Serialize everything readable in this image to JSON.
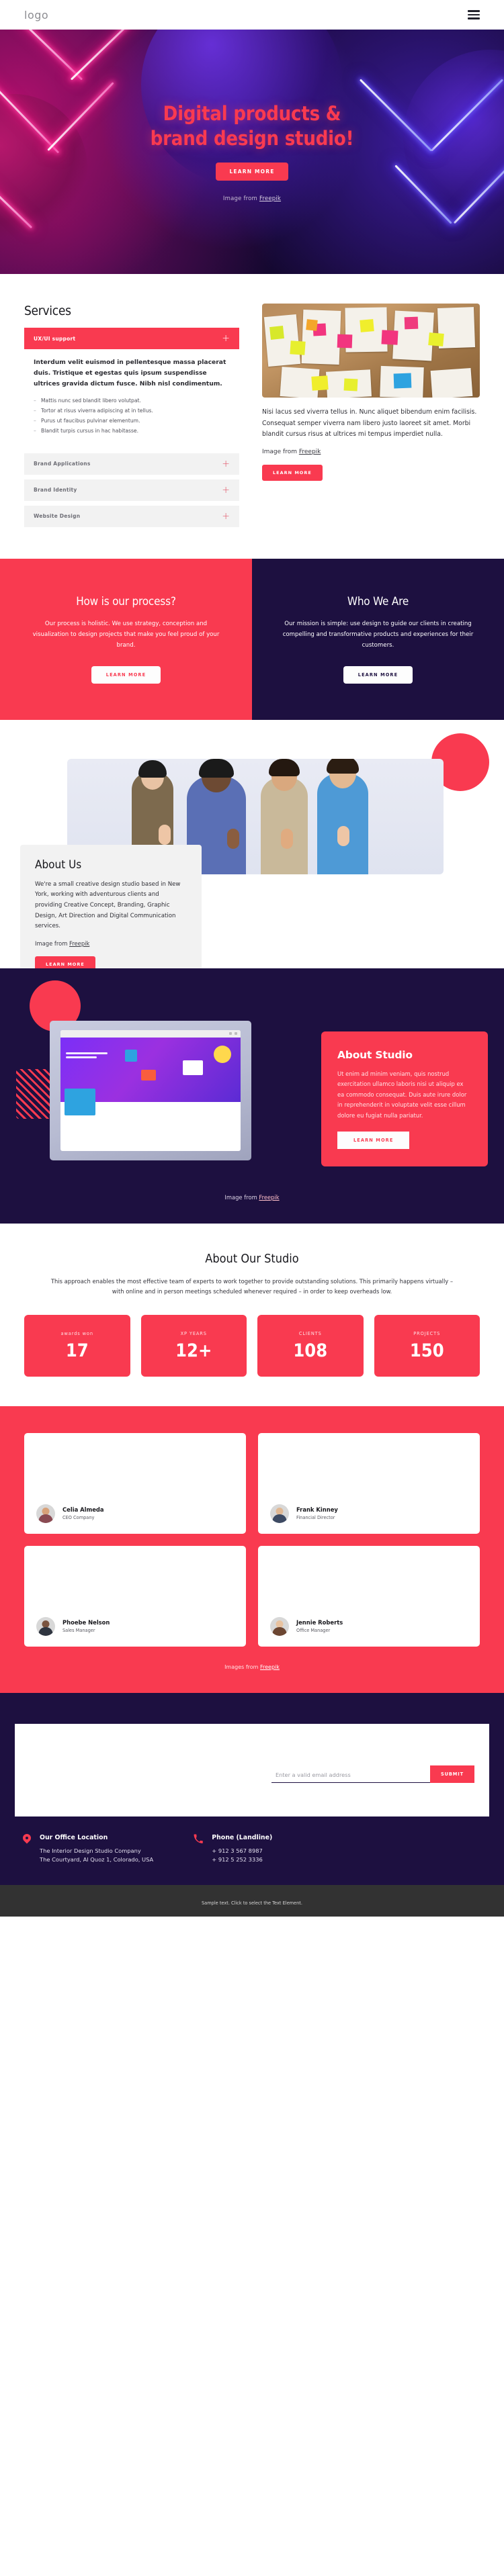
{
  "header": {
    "logo": "logo",
    "menu_icon": "hamburger-menu-icon"
  },
  "hero": {
    "title_line1": "Digital products &",
    "title_line2": "brand design studio!",
    "cta": "LEARN MORE",
    "credit_prefix": "Image from ",
    "credit_link": "Freepik"
  },
  "services": {
    "heading": "Services",
    "accordion": [
      {
        "label": "UX/UI support",
        "open": true,
        "body": "Interdum velit euismod in pellentesque massa placerat duis. Tristique et egestas quis ipsum suspendisse ultrices gravida dictum fusce. Nibh nisl condimentum.",
        "bullets": [
          "Mattis nunc sed blandit libero volutpat.",
          "Tortor at risus viverra adipiscing at in tellus.",
          "Purus ut faucibus pulvinar elementum.",
          "Blandit turpis cursus in hac habitasse."
        ]
      },
      {
        "label": "Brand Applications",
        "open": false
      },
      {
        "label": "Brand Identity",
        "open": false
      },
      {
        "label": "Website Design",
        "open": false
      }
    ],
    "paragraph": "Nisi lacus sed viverra tellus in. Nunc aliquet bibendum enim facilisis. Consequat semper viverra nam libero justo laoreet sit amet. Morbi blandit cursus risus at ultrices mi tempus imperdiet nulla.",
    "credit_prefix": "Image from ",
    "credit_link": "Freepik",
    "cta": "LEARN MORE"
  },
  "split": {
    "left": {
      "heading": "How is our process?",
      "text": "Our process is holistic. We use strategy, conception and visualization to design projects that make you feel proud of your brand.",
      "cta": "LEARN MORE"
    },
    "right": {
      "heading": "Who We Are",
      "text": "Our mission is simple: use design to guide our clients in creating compelling and transformative products and experiences for their customers.",
      "cta": "LEARN MORE"
    }
  },
  "about": {
    "heading": "About Us",
    "text": "We're a small creative design studio based in New York, working with adventurous clients and providing Creative Concept, Branding, Graphic Design, Art Direction and Digital Communication services.",
    "credit_prefix": "Image from ",
    "credit_link": "Freepik",
    "cta": "LEARN MORE"
  },
  "studio": {
    "heading": "About Studio",
    "text": "Ut enim ad minim veniam, quis nostrud exercitation ullamco laboris nisi ut aliquip ex ea commodo consequat. Duis aute irure dolor in reprehenderit in voluptate velit esse cillum dolore eu fugiat nulla pariatur.",
    "cta": "LEARN MORE",
    "credit_prefix": "Image from ",
    "credit_link": "Freepik"
  },
  "stats": {
    "heading": "About Our Studio",
    "paragraph": "This approach enables the most effective team of experts to work together to provide outstanding solutions. This primarily happens virtually – with online and in person meetings scheduled whenever required – in order to keep overheads low.",
    "items": [
      {
        "label": "awards won",
        "value": "17"
      },
      {
        "label": "XP YEARS",
        "value": "12+"
      },
      {
        "label": "CLIENTS",
        "value": "108"
      },
      {
        "label": "PROJECTS",
        "value": "150"
      }
    ]
  },
  "testimonials": {
    "people": [
      {
        "name": "Celia Almeda",
        "role": "CEO Company"
      },
      {
        "name": "Frank Kinney",
        "role": "Financial Director"
      },
      {
        "name": "Phoebe Nelson",
        "role": "Sales Manager"
      },
      {
        "name": "Jennie Roberts",
        "role": "Office Manager"
      }
    ],
    "credit_prefix": "Images from ",
    "credit_link": "Freepik"
  },
  "footer": {
    "email_placeholder": "Enter a valid email address",
    "submit_label": "SUBMIT",
    "office": {
      "icon": "map-pin-icon",
      "title": "Our Office Location",
      "line1": "The Interior Design Studio Company",
      "line2": "The Courtyard, Al Quoz 1, Colorado,  USA"
    },
    "phone": {
      "icon": "phone-icon",
      "title": "Phone (Landline)",
      "line1": "+ 912 3 567 8987",
      "line2": "+ 912 5 252 3336"
    },
    "bottom_text": "Sample text. Click to select the Text Element."
  },
  "colors": {
    "accent": "#f93a50",
    "dark": "#1d1040",
    "light_gray": "#f2f2f2"
  }
}
